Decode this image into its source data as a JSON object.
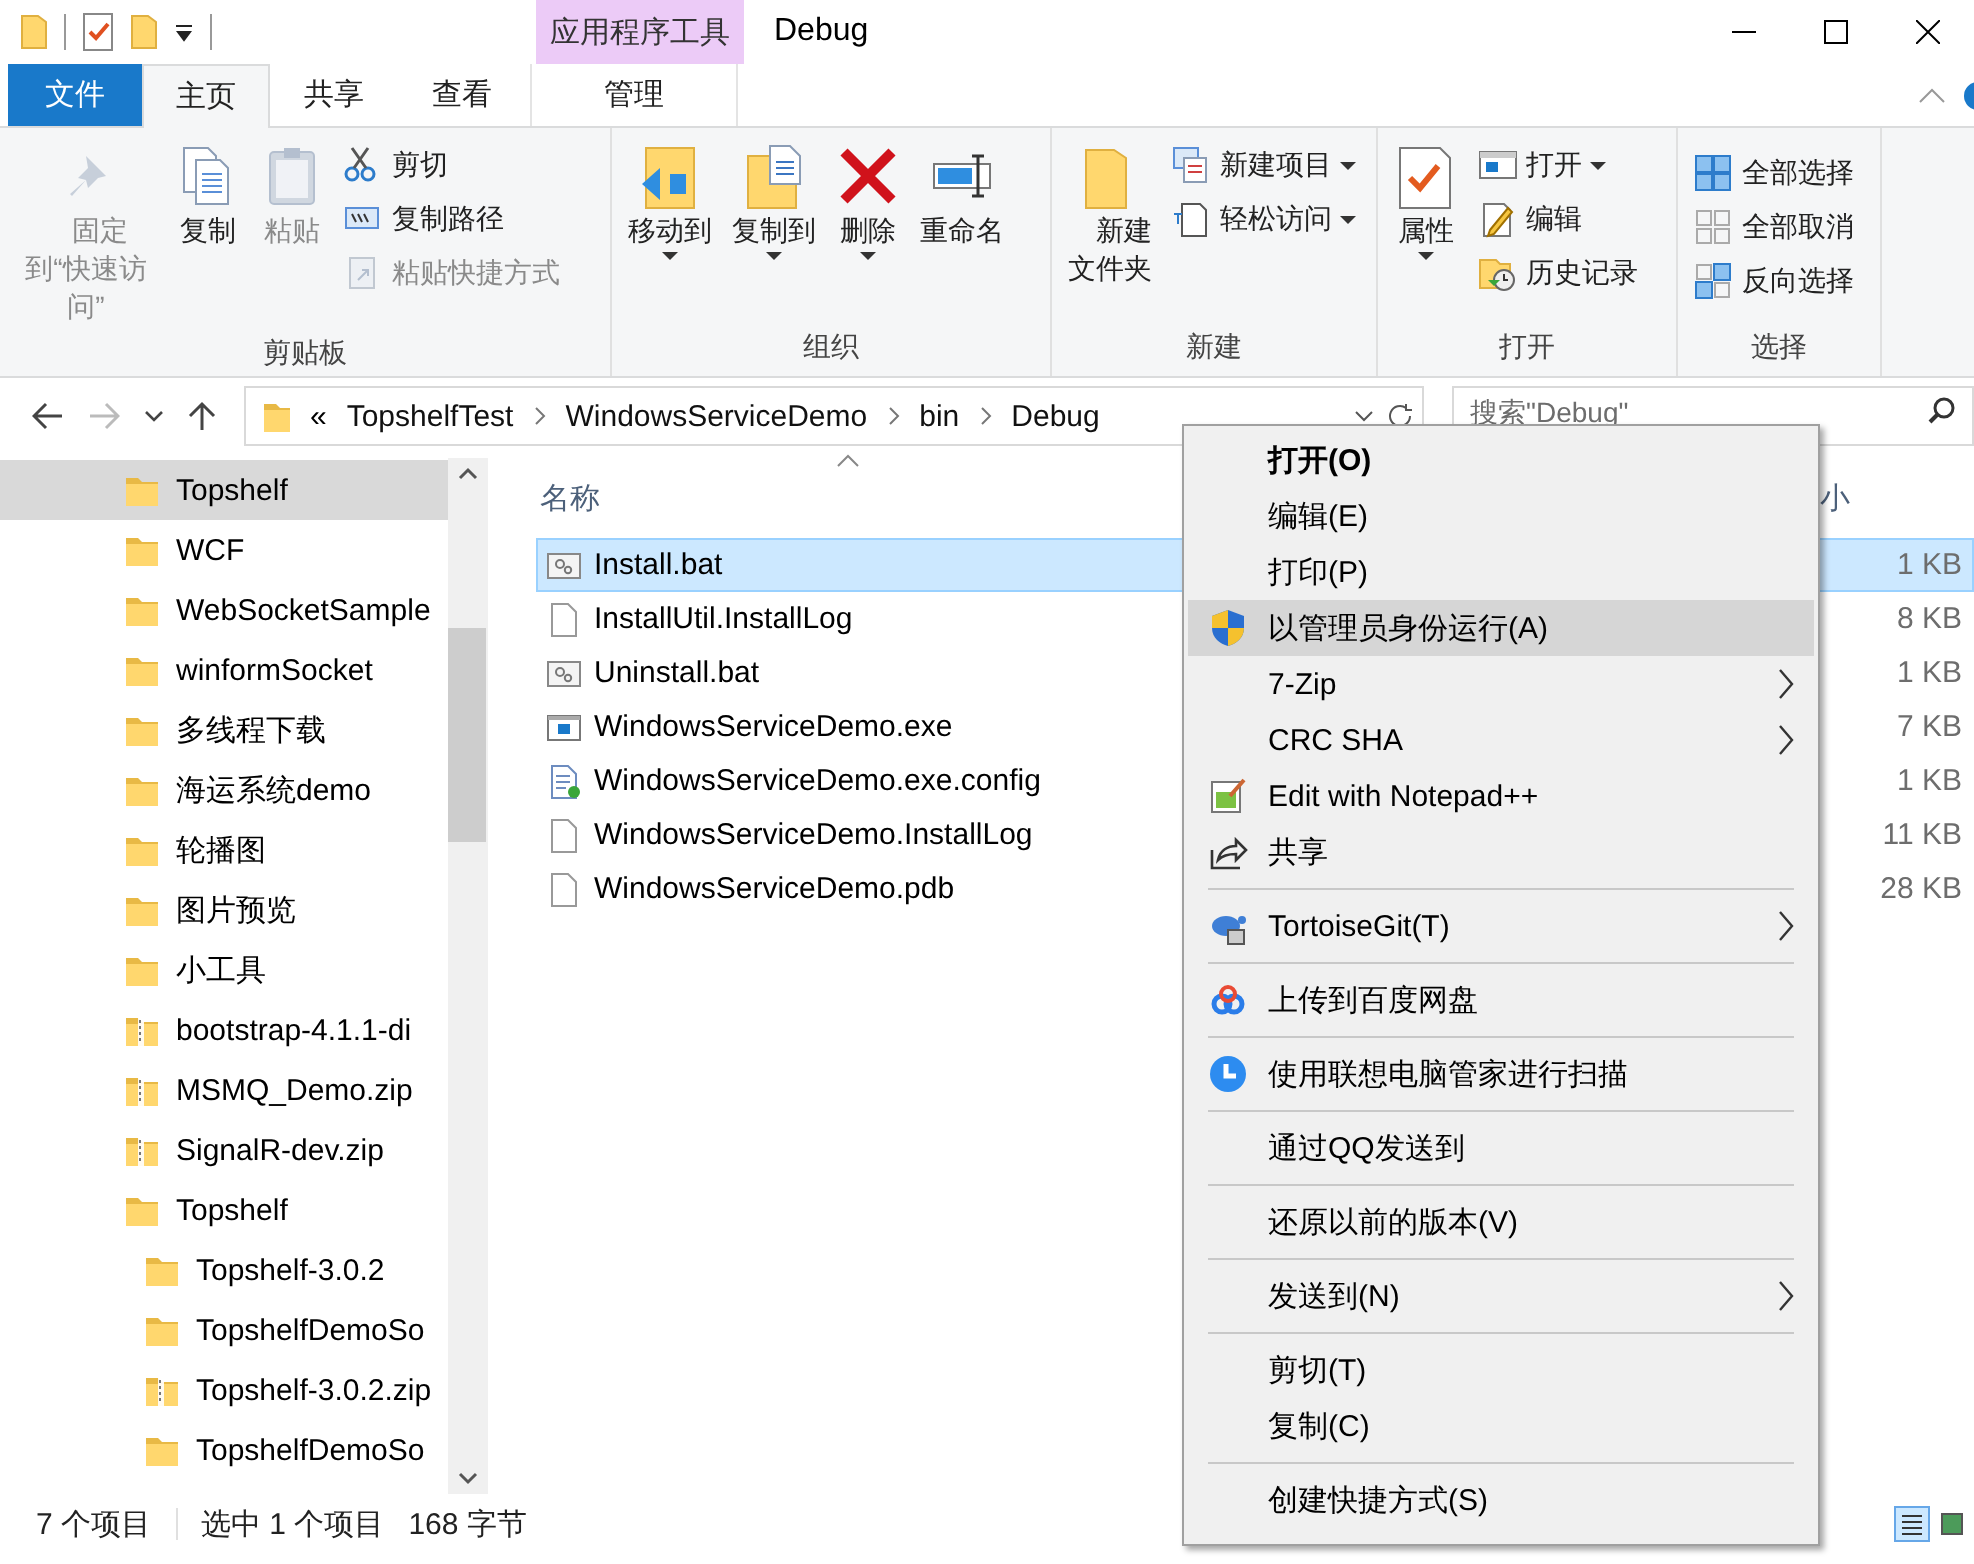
{
  "window": {
    "title": "Debug",
    "context_tab_header": "应用程序工具"
  },
  "ribbon_tabs": [
    {
      "label": "文件",
      "kind": "file",
      "selected": false
    },
    {
      "label": "主页",
      "kind": "tab",
      "selected": true
    },
    {
      "label": "共享",
      "kind": "tab",
      "selected": false
    },
    {
      "label": "查看",
      "kind": "tab",
      "selected": false
    },
    {
      "label": "管理",
      "kind": "context",
      "selected": false
    }
  ],
  "ribbon_groups": [
    {
      "label": "剪贴板",
      "columns": [
        {
          "kind": "large",
          "items": [
            {
              "label": "固定到“快速访问”",
              "disabled": true,
              "dropdown": false
            }
          ]
        },
        {
          "kind": "large",
          "items": [
            {
              "label": "复制",
              "disabled": false,
              "dropdown": false
            }
          ]
        },
        {
          "kind": "large",
          "items": [
            {
              "label": "粘贴",
              "disabled": true,
              "dropdown": false
            }
          ]
        },
        {
          "kind": "stack",
          "items": [
            {
              "label": "剪切",
              "disabled": false,
              "dropdown": false
            },
            {
              "label": "复制路径",
              "disabled": false,
              "dropdown": false
            },
            {
              "label": "粘贴快捷方式",
              "disabled": true,
              "dropdown": false
            }
          ]
        }
      ]
    },
    {
      "label": "组织",
      "columns": [
        {
          "kind": "large",
          "items": [
            {
              "label": "移动到",
              "disabled": false,
              "dropdown": true
            }
          ]
        },
        {
          "kind": "large",
          "items": [
            {
              "label": "复制到",
              "disabled": false,
              "dropdown": true
            }
          ]
        },
        {
          "kind": "large",
          "items": [
            {
              "label": "删除",
              "disabled": false,
              "dropdown": true
            }
          ]
        },
        {
          "kind": "large",
          "items": [
            {
              "label": "重命名",
              "disabled": false,
              "dropdown": false
            }
          ]
        }
      ]
    },
    {
      "label": "新建",
      "columns": [
        {
          "kind": "large",
          "items": [
            {
              "label": "新建文件夹",
              "disabled": false,
              "dropdown": false
            }
          ]
        },
        {
          "kind": "stack",
          "items": [
            {
              "label": "新建项目",
              "disabled": false,
              "dropdown": true
            },
            {
              "label": "轻松访问",
              "disabled": false,
              "dropdown": true
            }
          ]
        }
      ]
    },
    {
      "label": "打开",
      "columns": [
        {
          "kind": "large",
          "items": [
            {
              "label": "属性",
              "disabled": false,
              "dropdown": true
            }
          ]
        },
        {
          "kind": "stack",
          "items": [
            {
              "label": "打开",
              "disabled": false,
              "dropdown": true
            },
            {
              "label": "编辑",
              "disabled": false,
              "dropdown": false
            },
            {
              "label": "历史记录",
              "disabled": false,
              "dropdown": false
            }
          ]
        }
      ]
    },
    {
      "label": "选择",
      "columns": [
        {
          "kind": "stack",
          "items": [
            {
              "label": "全部选择",
              "disabled": false,
              "dropdown": false
            },
            {
              "label": "全部取消",
              "disabled": false,
              "dropdown": false
            },
            {
              "label": "反向选择",
              "disabled": false,
              "dropdown": false
            }
          ]
        }
      ]
    }
  ],
  "address_bar": {
    "overflow": "«",
    "crumbs": [
      "TopshelfTest",
      "WindowsServiceDemo",
      "bin",
      "Debug"
    ]
  },
  "search": {
    "placeholder": "搜索\"Debug\""
  },
  "navigation": [
    {
      "label": "Topshelf",
      "kind": "folder",
      "selected": true
    },
    {
      "label": "WCF",
      "kind": "folder",
      "selected": false
    },
    {
      "label": "WebSocketSample",
      "kind": "folder",
      "selected": false
    },
    {
      "label": "winformSocket",
      "kind": "folder",
      "selected": false
    },
    {
      "label": "多线程下载",
      "kind": "folder",
      "selected": false
    },
    {
      "label": "海运系统demo",
      "kind": "folder",
      "selected": false
    },
    {
      "label": "轮播图",
      "kind": "folder",
      "selected": false
    },
    {
      "label": "图片预览",
      "kind": "folder",
      "selected": false
    },
    {
      "label": "小工具",
      "kind": "folder",
      "selected": false
    },
    {
      "label": "bootstrap-4.1.1-di",
      "kind": "zip",
      "selected": false
    },
    {
      "label": "MSMQ_Demo.zip",
      "kind": "zip",
      "selected": false
    },
    {
      "label": "SignalR-dev.zip",
      "kind": "zip",
      "selected": false
    },
    {
      "label": "Topshelf",
      "kind": "folder",
      "selected": false,
      "children": [
        {
          "label": "Topshelf-3.0.2",
          "kind": "folder",
          "selected": false
        },
        {
          "label": "TopshelfDemoSo",
          "kind": "folder",
          "selected": false
        },
        {
          "label": "Topshelf-3.0.2.zip",
          "kind": "zip",
          "selected": false
        },
        {
          "label": "TopshelfDemoSo",
          "kind": "folder",
          "selected": false
        }
      ]
    }
  ],
  "file_list": {
    "columns": [
      "名称",
      "小"
    ],
    "rows": [
      {
        "name": "Install.bat",
        "kind": "bat",
        "size": "1 KB",
        "selected": true
      },
      {
        "name": "InstallUtil.InstallLog",
        "kind": "doc",
        "size": "8 KB",
        "selected": false
      },
      {
        "name": "Uninstall.bat",
        "kind": "bat",
        "size": "1 KB",
        "selected": false
      },
      {
        "name": "WindowsServiceDemo.exe",
        "kind": "exe",
        "size": "7 KB",
        "selected": false
      },
      {
        "name": "WindowsServiceDemo.exe.config",
        "kind": "config",
        "size": "1 KB",
        "selected": false
      },
      {
        "name": "WindowsServiceDemo.InstallLog",
        "kind": "doc",
        "size": "11 KB",
        "selected": false
      },
      {
        "name": "WindowsServiceDemo.pdb",
        "kind": "doc",
        "size": "28 KB",
        "selected": false
      }
    ]
  },
  "context_menu": [
    {
      "kind": "item",
      "label": "打开(O)",
      "bold": true,
      "submenu": false,
      "selected": false
    },
    {
      "kind": "item",
      "label": "编辑(E)",
      "bold": false,
      "submenu": false,
      "selected": false
    },
    {
      "kind": "item",
      "label": "打印(P)",
      "bold": false,
      "submenu": false,
      "selected": false
    },
    {
      "kind": "item",
      "label": "以管理员身份运行(A)",
      "bold": false,
      "submenu": false,
      "selected": true
    },
    {
      "kind": "item",
      "label": "7-Zip",
      "bold": false,
      "submenu": true,
      "selected": false
    },
    {
      "kind": "item",
      "label": "CRC SHA",
      "bold": false,
      "submenu": true,
      "selected": false
    },
    {
      "kind": "item",
      "label": "Edit with Notepad++",
      "bold": false,
      "submenu": false,
      "selected": false
    },
    {
      "kind": "item",
      "label": "共享",
      "bold": false,
      "submenu": false,
      "selected": false
    },
    {
      "kind": "separator"
    },
    {
      "kind": "item",
      "label": "TortoiseGit(T)",
      "bold": false,
      "submenu": true,
      "selected": false
    },
    {
      "kind": "separator"
    },
    {
      "kind": "item",
      "label": "上传到百度网盘",
      "bold": false,
      "submenu": false,
      "selected": false
    },
    {
      "kind": "separator"
    },
    {
      "kind": "item",
      "label": "使用联想电脑管家进行扫描",
      "bold": false,
      "submenu": false,
      "selected": false
    },
    {
      "kind": "separator"
    },
    {
      "kind": "item",
      "label": "通过QQ发送到",
      "bold": false,
      "submenu": false,
      "selected": false
    },
    {
      "kind": "separator"
    },
    {
      "kind": "item",
      "label": "还原以前的版本(V)",
      "bold": false,
      "submenu": false,
      "selected": false
    },
    {
      "kind": "separator"
    },
    {
      "kind": "item",
      "label": "发送到(N)",
      "bold": false,
      "submenu": true,
      "selected": false
    },
    {
      "kind": "separator"
    },
    {
      "kind": "item",
      "label": "剪切(T)",
      "bold": false,
      "submenu": false,
      "selected": false
    },
    {
      "kind": "item",
      "label": "复制(C)",
      "bold": false,
      "submenu": false,
      "selected": false
    },
    {
      "kind": "separator"
    },
    {
      "kind": "item",
      "label": "创建快捷方式(S)",
      "bold": false,
      "submenu": false,
      "selected": false
    }
  ],
  "status_bar": {
    "item_count": "7 个项目",
    "selection": "选中 1 个项目",
    "selection_size": "168 字节"
  },
  "view_buttons": [
    {
      "selected": true
    },
    {
      "selected": false
    }
  ]
}
